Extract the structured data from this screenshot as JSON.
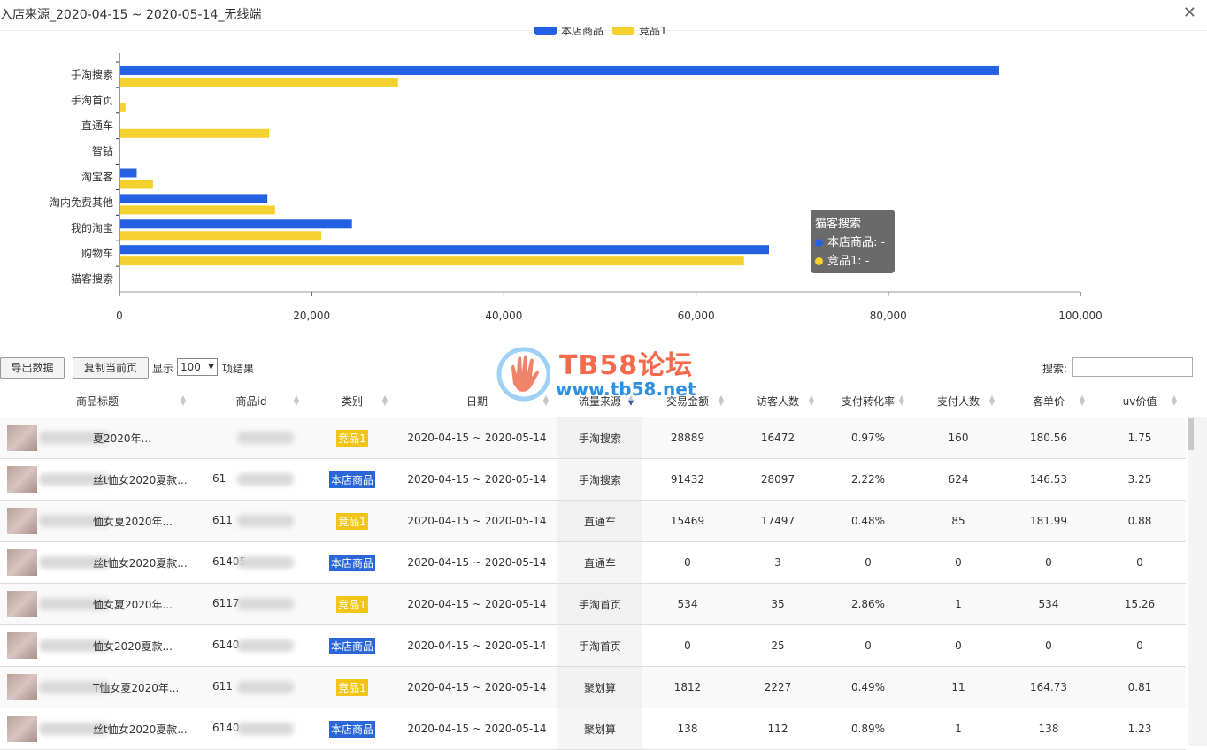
{
  "window": {
    "title": "入店来源_2020-04-15 ~ 2020-05-14_无线端",
    "close_symbol": "✕"
  },
  "chart_data": {
    "type": "bar",
    "orientation": "horizontal",
    "categories": [
      "手淘搜索",
      "手淘首页",
      "直通车",
      "智钻",
      "淘宝客",
      "淘内免费其他",
      "我的淘宝",
      "购物车",
      "猫客搜索"
    ],
    "series": [
      {
        "name": "本店商品",
        "color": "#2461e2",
        "values": [
          91432,
          0,
          0,
          0,
          1700,
          15300,
          24100,
          67500,
          null
        ]
      },
      {
        "name": "竞品1",
        "color": "#f5d130",
        "values": [
          28889,
          534,
          15469,
          0,
          3400,
          16100,
          20900,
          64900,
          null
        ]
      }
    ],
    "x_ticks": [
      "0",
      "20,000",
      "40,000",
      "60,000",
      "80,000",
      "100,000"
    ],
    "xlim": [
      0,
      100000
    ],
    "legend_position": "top-center"
  },
  "tooltip": {
    "title": "猫客搜索",
    "lines": [
      {
        "text": "本店商品: -",
        "color": "#2461e2"
      },
      {
        "text": "竞品1: -",
        "color": "#f5d130"
      }
    ]
  },
  "watermark": {
    "title": "TB58论坛",
    "url": "www.tb58.net"
  },
  "controls": {
    "export_label": "导出数据",
    "copy_label": "复制当前页",
    "show_label": "显示",
    "page_size": "100",
    "page_size_arrow": "▼",
    "results_label": "项结果",
    "search_label": "搜索:"
  },
  "table": {
    "columns": [
      "商品标题",
      "商品id",
      "类别",
      "日期",
      "流量来源",
      "交易金额",
      "访客人数",
      "支付转化率",
      "支付人数",
      "客单价",
      "uv价值"
    ],
    "sort_up": "▲",
    "sort_down": "▼",
    "colors": {
      "competitor_badge": "#f2c418",
      "own_badge": "#2b66d9"
    },
    "rows": [
      {
        "title": "夏2020年...",
        "id": "",
        "type": "竞品1",
        "kind": "competitor",
        "date": "2020-04-15 ~ 2020-05-14",
        "source": "手淘搜索",
        "amount": "28889",
        "visitors": "16472",
        "conversion": "0.97%",
        "buyers": "160",
        "unit_price": "180.56",
        "uv": "1.75"
      },
      {
        "title": "丝t恤女2020夏款...",
        "id": "61",
        "type": "本店商品",
        "kind": "own",
        "date": "2020-04-15 ~ 2020-05-14",
        "source": "手淘搜索",
        "amount": "91432",
        "visitors": "28097",
        "conversion": "2.22%",
        "buyers": "624",
        "unit_price": "146.53",
        "uv": "3.25"
      },
      {
        "title": "恤女夏2020年...",
        "id": "611",
        "type": "竞品1",
        "kind": "competitor",
        "date": "2020-04-15 ~ 2020-05-14",
        "source": "直通车",
        "amount": "15469",
        "visitors": "17497",
        "conversion": "0.48%",
        "buyers": "85",
        "unit_price": "181.99",
        "uv": "0.88"
      },
      {
        "title": "丝t恤女2020夏款...",
        "id": "61405",
        "type": "本店商品",
        "kind": "own",
        "date": "2020-04-15 ~ 2020-05-14",
        "source": "直通车",
        "amount": "0",
        "visitors": "3",
        "conversion": "0",
        "buyers": "0",
        "unit_price": "0",
        "uv": "0"
      },
      {
        "title": "恤女夏2020年...",
        "id": "6117",
        "type": "竞品1",
        "kind": "competitor",
        "date": "2020-04-15 ~ 2020-05-14",
        "source": "手淘首页",
        "amount": "534",
        "visitors": "35",
        "conversion": "2.86%",
        "buyers": "1",
        "unit_price": "534",
        "uv": "15.26"
      },
      {
        "title": "恤女2020夏款...",
        "id": "6140",
        "type": "本店商品",
        "kind": "own",
        "date": "2020-04-15 ~ 2020-05-14",
        "source": "手淘首页",
        "amount": "0",
        "visitors": "25",
        "conversion": "0",
        "buyers": "0",
        "unit_price": "0",
        "uv": "0"
      },
      {
        "title": "T恤女夏2020年...",
        "id": "611",
        "type": "竞品1",
        "kind": "competitor",
        "date": "2020-04-15 ~ 2020-05-14",
        "source": "聚划算",
        "amount": "1812",
        "visitors": "2227",
        "conversion": "0.49%",
        "buyers": "11",
        "unit_price": "164.73",
        "uv": "0.81"
      },
      {
        "title": "丝t恤女2020夏款...",
        "id": "6140",
        "type": "本店商品",
        "kind": "own",
        "date": "2020-04-15 ~ 2020-05-14",
        "source": "聚划算",
        "amount": "138",
        "visitors": "112",
        "conversion": "0.89%",
        "buyers": "1",
        "unit_price": "138",
        "uv": "1.23"
      }
    ]
  }
}
